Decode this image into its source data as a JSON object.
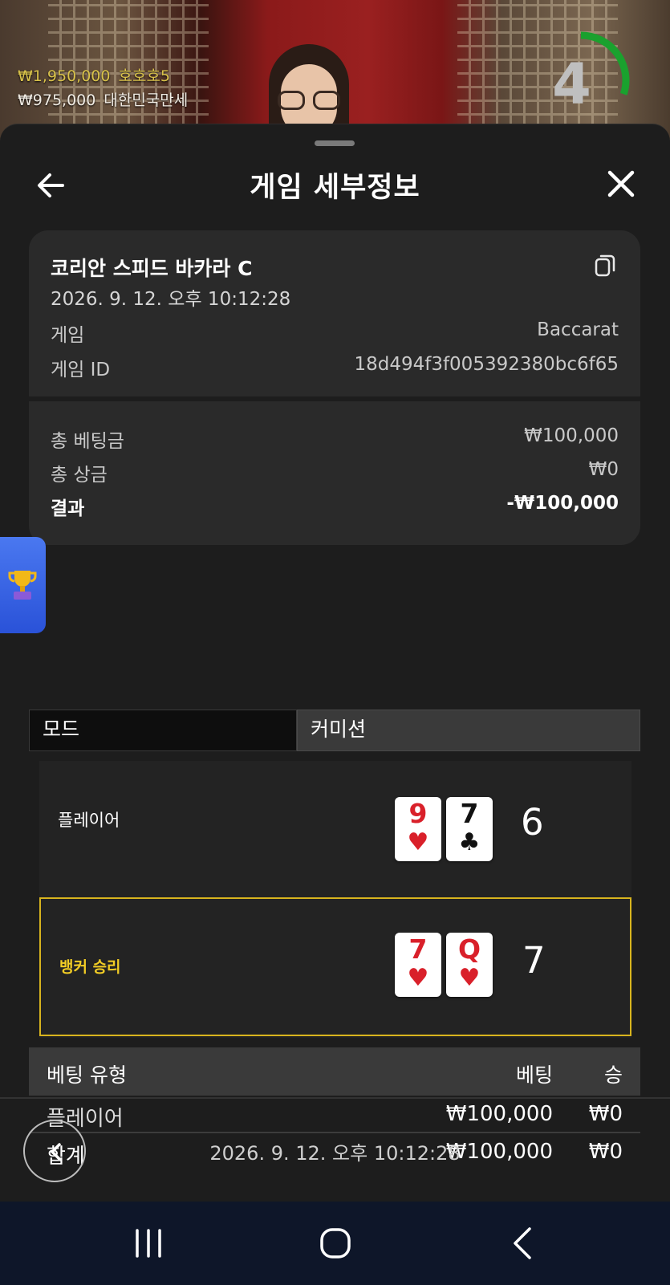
{
  "leaderboard": [
    {
      "amount": "₩1,950,000",
      "name": "호호호5",
      "style": "gold"
    },
    {
      "amount": "₩975,000",
      "name": "대한민국만세",
      "style": "white"
    }
  ],
  "timer": {
    "value": "4",
    "progress": 0.3,
    "color": "#1aa12e"
  },
  "sheet": {
    "title": "게임 세부정보"
  },
  "game": {
    "name": "코리안 스피드 바카라 C",
    "datetime": "2026. 9. 12. 오후 10:12:28",
    "type_label": "게임",
    "type_value": "Baccarat",
    "id_label": "게임 ID",
    "id_value": "18d494f3f005392380bc6f65"
  },
  "summary": {
    "total_bet_label": "총 베팅금",
    "total_bet_value": "₩100,000",
    "total_prize_label": "총 상금",
    "total_prize_value": "₩0",
    "result_label": "결과",
    "result_value": "-₩100,000"
  },
  "mode": {
    "left_label": "모드",
    "right_label": "커미션"
  },
  "hands": {
    "player": {
      "label": "플레이어",
      "cards": [
        {
          "rank": "9",
          "suit": "♥",
          "color": "red"
        },
        {
          "rank": "7",
          "suit": "♣",
          "color": "black"
        }
      ],
      "score": "6"
    },
    "banker": {
      "label": "뱅커 승리",
      "cards": [
        {
          "rank": "7",
          "suit": "♥",
          "color": "red"
        },
        {
          "rank": "Q",
          "suit": "♥",
          "color": "red"
        }
      ],
      "score": "7"
    }
  },
  "bets": {
    "headers": {
      "type": "베팅 유형",
      "bet": "베팅",
      "win": "승"
    },
    "rows": [
      {
        "type": "플레이어",
        "bet": "₩100,000",
        "win": "₩0"
      }
    ],
    "total": {
      "type": "합계",
      "bet": "₩100,000",
      "win": "₩0"
    }
  },
  "footer": {
    "datetime": "2026. 9. 12. 오후 10:12:28"
  },
  "icons": {
    "back": "arrow-left-icon",
    "close": "close-icon",
    "copy": "copy-icon",
    "trophy": "trophy-icon",
    "prev": "chevron-left-icon",
    "nav_recents": "recents-icon",
    "nav_home": "home-icon",
    "nav_back": "back-icon"
  },
  "colors": {
    "win_highlight": "#d8b41e",
    "sheet_bg": "#1d1d1d",
    "card_bg": "#2a2a2a"
  }
}
